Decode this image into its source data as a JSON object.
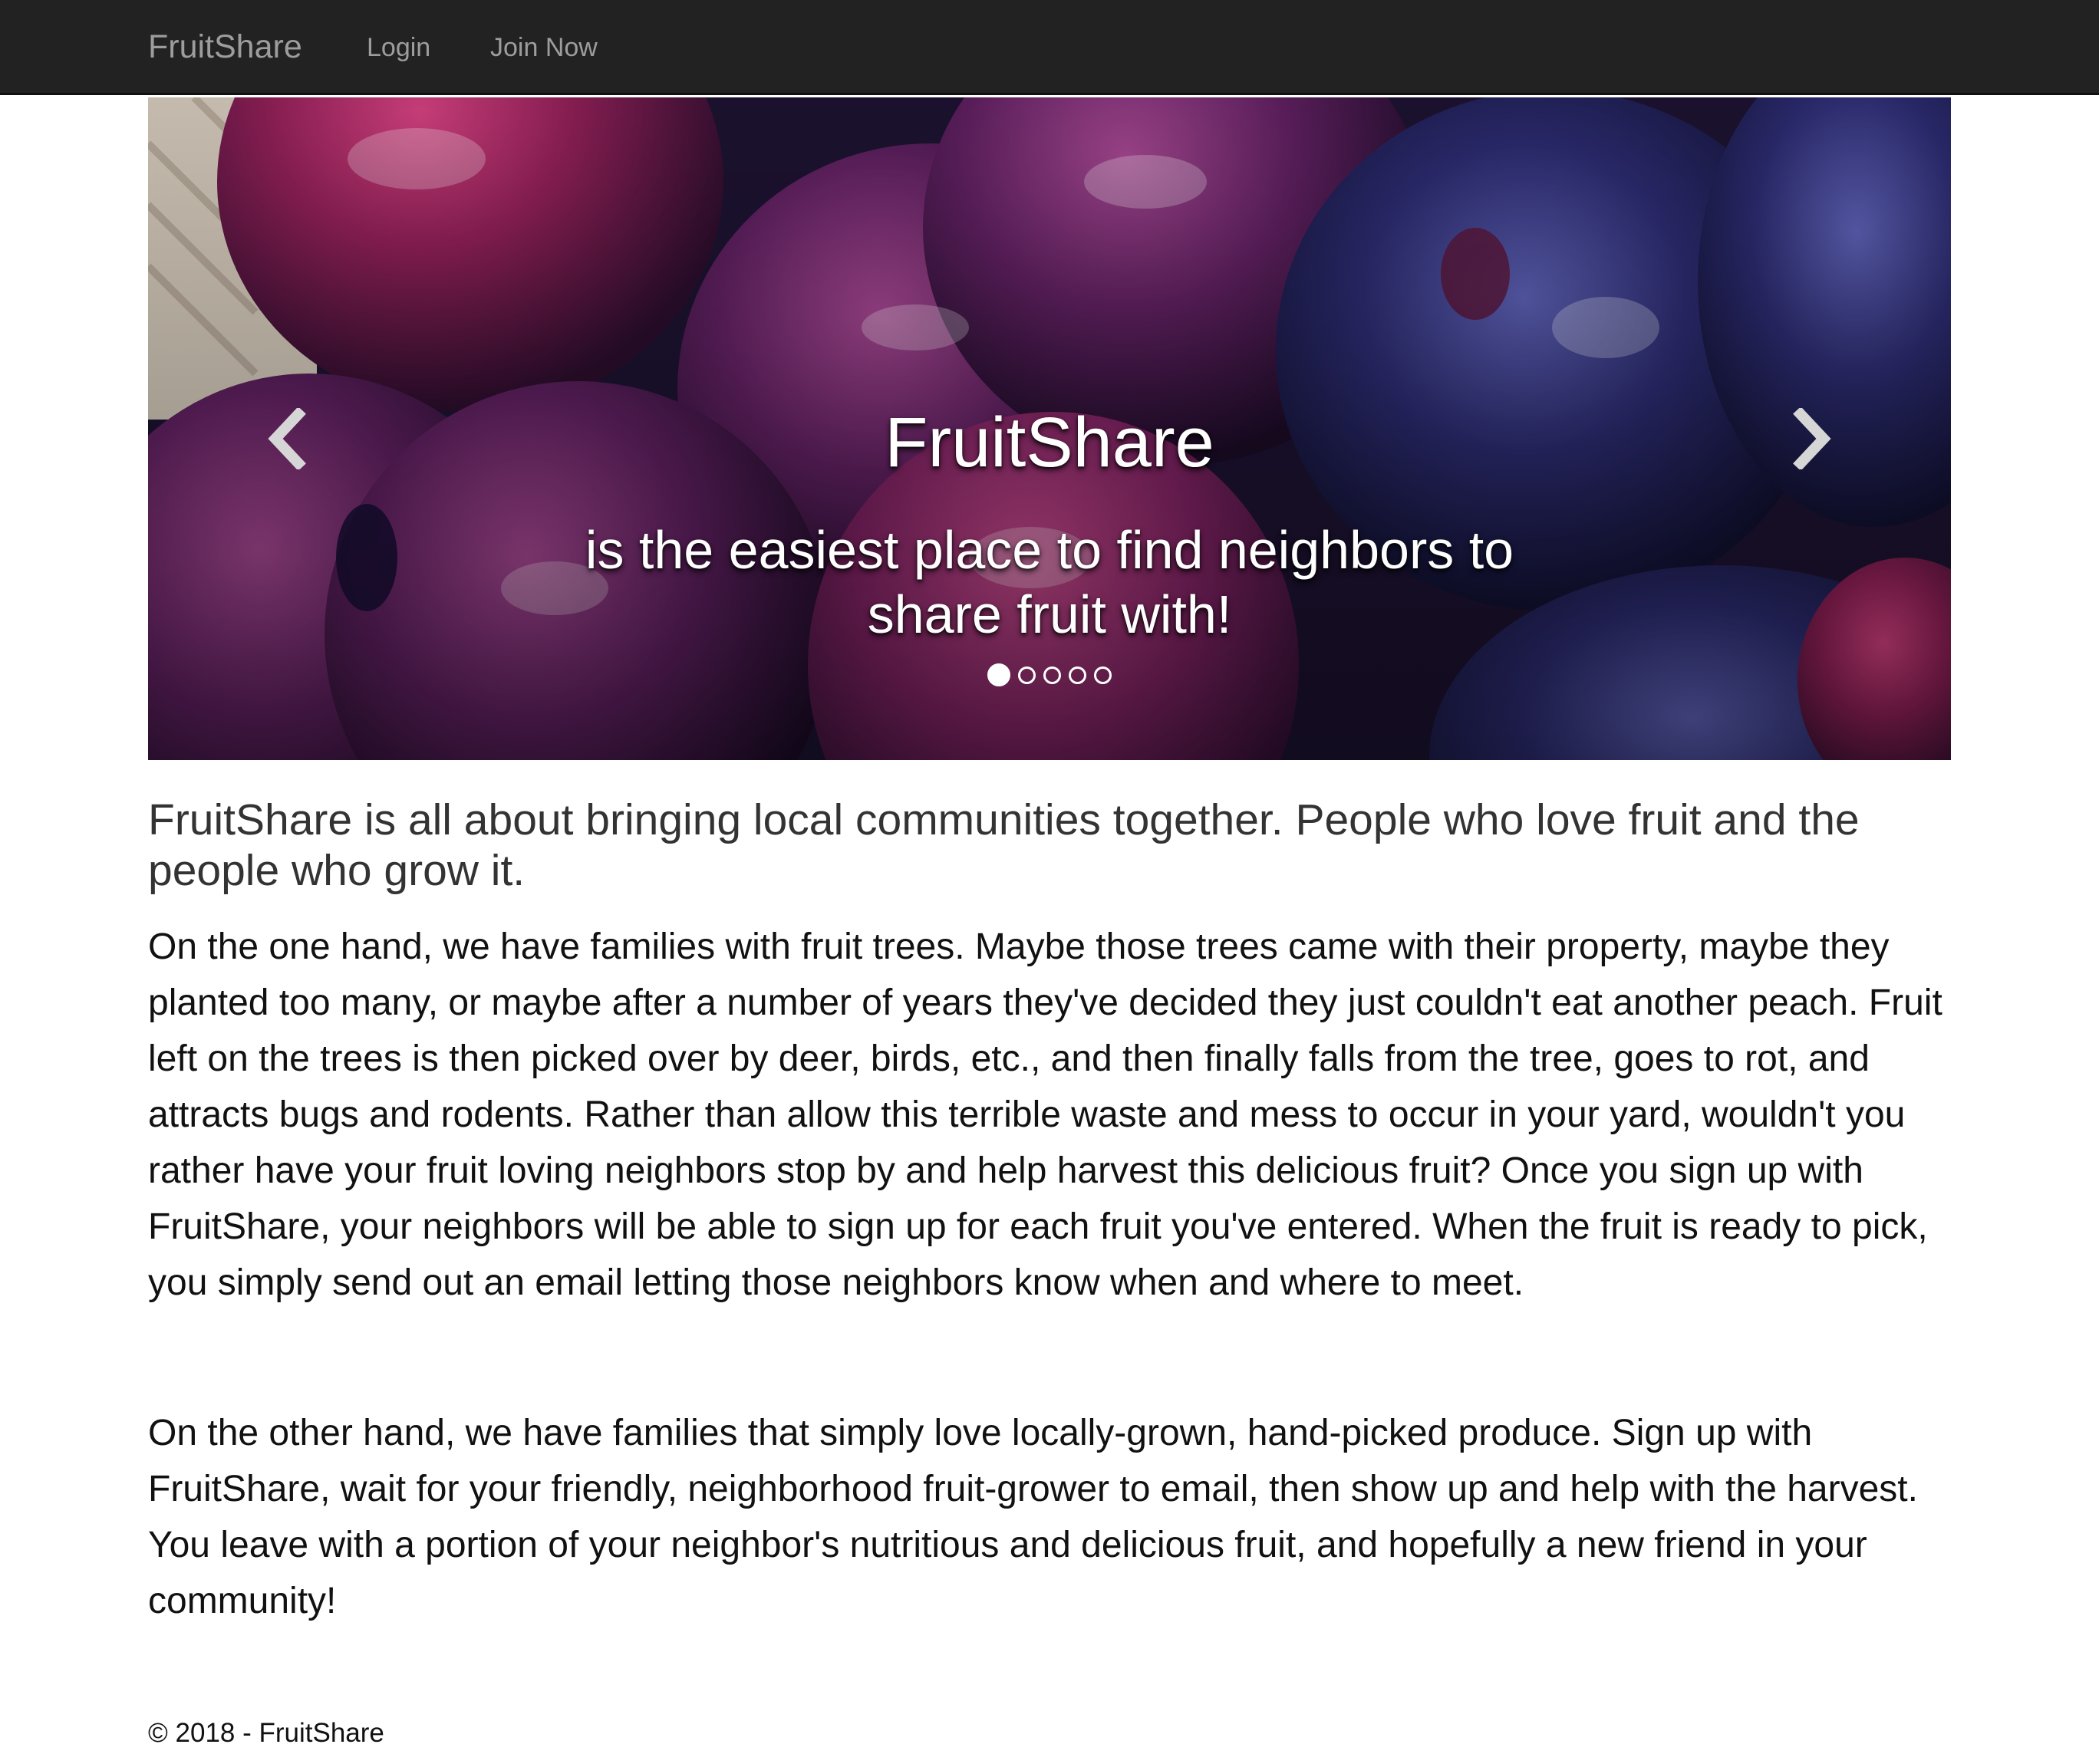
{
  "navbar": {
    "brand": "FruitShare",
    "links": [
      {
        "label": "Login"
      },
      {
        "label": "Join Now"
      }
    ]
  },
  "carousel": {
    "title": "FruitShare",
    "subtitle": "is the easiest place to find neighbors to share fruit with!",
    "slide_count": 5,
    "active_slide": 1,
    "prev_icon": "chevron-left-icon",
    "next_icon": "chevron-right-icon",
    "image_subject": "plums"
  },
  "content": {
    "lead": "FruitShare is all about bringing local communities together. People who love fruit and the people who grow it.",
    "paragraphs": [
      "On the one hand, we have families with fruit trees. Maybe those trees came with their property, maybe they planted too many, or maybe after a number of years they've decided they just couldn't eat another peach. Fruit left on the trees is then picked over by deer, birds, etc., and then finally falls from the tree, goes to rot, and attracts bugs and rodents. Rather than allow this terrible waste and mess to occur in your yard, wouldn't you rather have your fruit loving neighbors stop by and help harvest this delicious fruit? Once you sign up with FruitShare, your neighbors will be able to sign up for each fruit you've entered. When the fruit is ready to pick, you simply send out an email letting those neighbors know when and where to meet.",
      "On the other hand, we have families that simply love locally-grown, hand-picked produce. Sign up with FruitShare, wait for your friendly, neighborhood fruit-grower to email, then show up and help with the harvest. You leave with a portion of your neighbor's nutritious and delicious fruit, and hopefully a new friend in your community!"
    ]
  },
  "footer": {
    "text": "© 2018 - FruitShare"
  },
  "colors": {
    "navbar_bg": "#222222",
    "nav_text": "#9d9d9d",
    "plum_red": "#8a1e52",
    "plum_blue": "#2b2a6e"
  }
}
